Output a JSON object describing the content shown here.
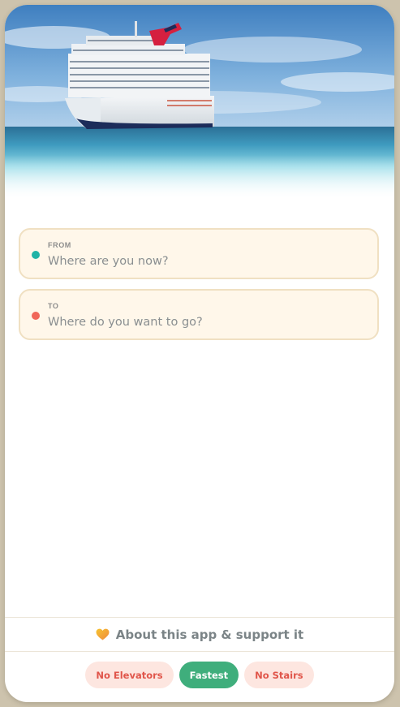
{
  "hero": {
    "image": "cruise-ship-on-ocean"
  },
  "route": {
    "from": {
      "label": "FROM",
      "placeholder": "Where are you now?",
      "value": "",
      "dot_color": "#1fb3a6"
    },
    "to": {
      "label": "TO",
      "placeholder": "Where do you want to go?",
      "value": "",
      "dot_color": "#f0675a"
    }
  },
  "footer": {
    "about_icon": "heart-icon",
    "about_label": "About this app & support it",
    "modes": [
      {
        "label": "No Elevators",
        "active": false
      },
      {
        "label": "Fastest",
        "active": true
      },
      {
        "label": "No Stairs",
        "active": false
      }
    ]
  },
  "colors": {
    "accent_green": "#3fae7c",
    "accent_red": "#e0554a",
    "card_bg": "#fff7ea",
    "card_border": "#f0e0c2",
    "page_bg": "#cdc3ad"
  }
}
